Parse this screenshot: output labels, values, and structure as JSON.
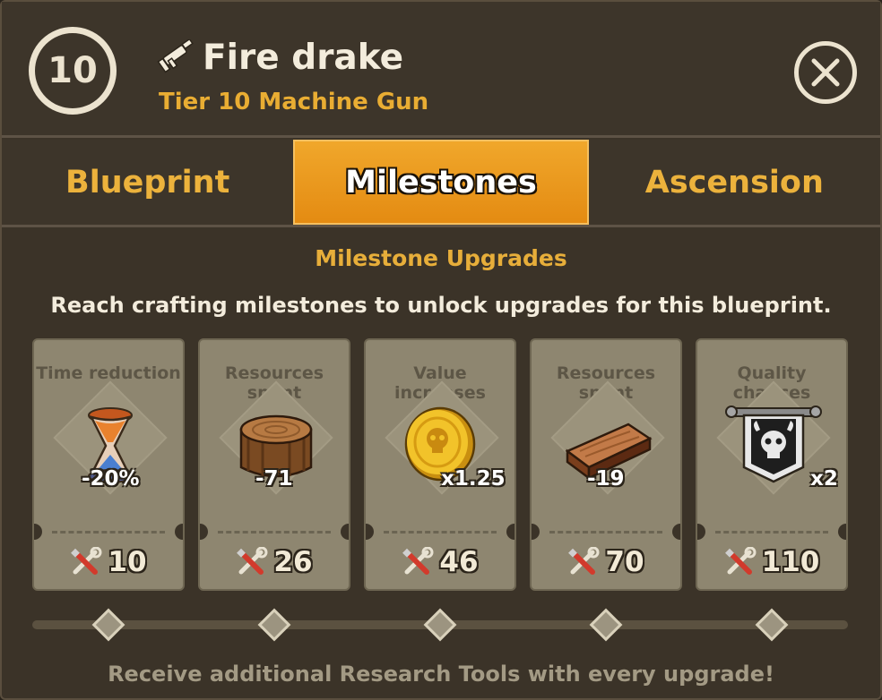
{
  "header": {
    "level": "10",
    "title": "Fire drake",
    "subtitle": "Tier 10 Machine Gun"
  },
  "tabs": [
    {
      "label": "Blueprint",
      "active": false
    },
    {
      "label": "Milestones",
      "active": true
    },
    {
      "label": "Ascension",
      "active": false
    }
  ],
  "section": {
    "title": "Milestone Upgrades",
    "description": "Reach crafting milestones to unlock upgrades for this blueprint."
  },
  "milestones": [
    {
      "label": "Time reduction",
      "icon": "hourglass-icon",
      "value": "-20%",
      "required": "10"
    },
    {
      "label": "Resources spent",
      "icon": "wood-log-icon",
      "value": "-71",
      "required": "26"
    },
    {
      "label": "Value increases",
      "icon": "gold-coin-icon",
      "value": "x1.25",
      "required": "46"
    },
    {
      "label": "Resources spent",
      "icon": "wood-plank-icon",
      "value": "-19",
      "required": "70"
    },
    {
      "label": "Quality chances",
      "icon": "skull-banner-icon",
      "value": "x2",
      "required": "110"
    }
  ],
  "footer": {
    "text": "Receive additional Research Tools with every upgrade!"
  },
  "colors": {
    "accent": "#e9ad33",
    "active_tab": "#e8951a",
    "panel": "#3b3328",
    "card": "#8e8670"
  }
}
